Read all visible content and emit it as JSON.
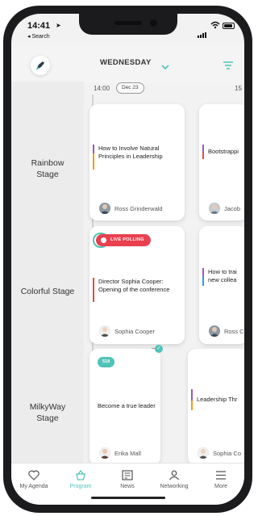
{
  "status": {
    "time": "14:41",
    "back_label": "◂ Search"
  },
  "header": {
    "day": "WEDNESDAY",
    "logo_icon": "pen-logo-icon",
    "filter_icon": "filter-icon"
  },
  "timeline": {
    "start_time": "14:00",
    "date": "Dec 23",
    "next_time": "15"
  },
  "stages": [
    {
      "name_line1": "Rainbow",
      "name_line2": "Stage"
    },
    {
      "name_line1": "Colorful Stage",
      "name_line2": ""
    },
    {
      "name_line1": "MilkyWay",
      "name_line2": "Stage"
    }
  ],
  "sessions": [
    {
      "title": "How to Involve Natural Principles in Leadership",
      "speaker": "Ross Grinderwald",
      "bar_colors": [
        "#9b59b6",
        "#f39c12"
      ]
    },
    {
      "title": "Bootstrappi",
      "speaker": "Jacob",
      "bar_colors": [
        "#9b59b6",
        "#e74c3c"
      ]
    },
    {
      "title": "Director Sophia Cooper: Opening of the conference",
      "speaker": "Sophia Cooper",
      "live_label": "LIVE POLLING",
      "bar_colors": [
        "#e74c3c"
      ]
    },
    {
      "title": "How to trai new collea",
      "speaker": "Ross C",
      "bar_colors": [
        "#9b59b6",
        "#3498db"
      ]
    },
    {
      "title": "Become a true leader",
      "speaker": "Erika Mall",
      "badge": "518",
      "bar_colors": []
    },
    {
      "title": "Leadership Thr",
      "speaker": "Sophia Co",
      "bar_colors": [
        "#9b59b6",
        "#f39c12"
      ]
    }
  ],
  "tabs": [
    {
      "label": "My Agenda",
      "icon": "heart-icon"
    },
    {
      "label": "Program",
      "icon": "basket-icon"
    },
    {
      "label": "News",
      "icon": "news-icon"
    },
    {
      "label": "Networking",
      "icon": "people-icon"
    },
    {
      "label": "More",
      "icon": "menu-icon"
    }
  ],
  "colors": {
    "accent": "#4fc3b8",
    "live": "#e8404f"
  }
}
